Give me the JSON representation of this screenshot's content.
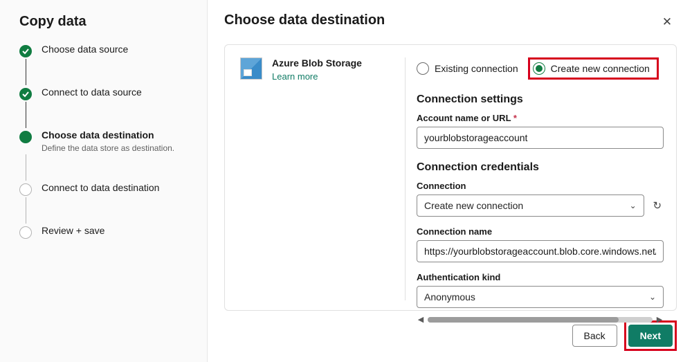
{
  "sidebar": {
    "title": "Copy data",
    "steps": [
      {
        "label": "Choose data source",
        "state": "done"
      },
      {
        "label": "Connect to data source",
        "state": "done"
      },
      {
        "label": "Choose data destination",
        "state": "current",
        "sub": "Define the data store as destination."
      },
      {
        "label": "Connect to data destination",
        "state": "pending"
      },
      {
        "label": "Review + save",
        "state": "pending"
      }
    ]
  },
  "main": {
    "title": "Choose data destination",
    "datastore": {
      "name": "Azure Blob Storage",
      "learn_more": "Learn more"
    },
    "connection_mode": {
      "existing_label": "Existing connection",
      "create_label": "Create new connection",
      "selected": "create"
    },
    "settings_heading": "Connection settings",
    "account": {
      "label": "Account name or URL",
      "required": true,
      "value": "yourblobstorageaccount"
    },
    "credentials_heading": "Connection credentials",
    "connection_dropdown": {
      "label": "Connection",
      "selected": "Create new connection"
    },
    "connection_name": {
      "label": "Connection name",
      "value": "https://yourblobstorageaccount.blob.core.windows.net/"
    },
    "auth_kind": {
      "label": "Authentication kind",
      "selected": "Anonymous"
    }
  },
  "footer": {
    "back": "Back",
    "next": "Next"
  }
}
